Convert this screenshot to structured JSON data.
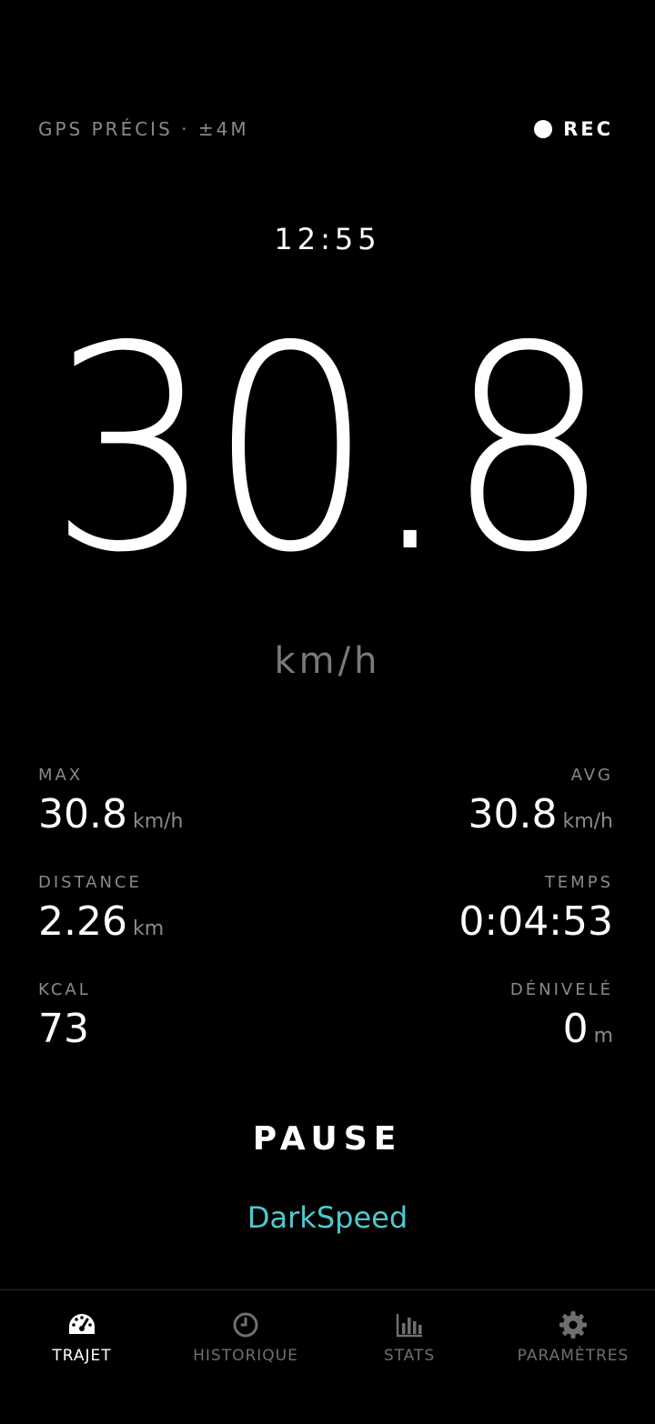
{
  "status": {
    "gps": "GPS PRÉCIS · ±4M",
    "rec_label": "REC"
  },
  "clock": "12:55",
  "speed": {
    "value": "30.8",
    "unit": "km/h"
  },
  "stats": {
    "max": {
      "label": "MAX",
      "value": "30.8",
      "unit": "km/h"
    },
    "avg": {
      "label": "AVG",
      "value": "30.8",
      "unit": "km/h"
    },
    "distance": {
      "label": "DISTANCE",
      "value": "2.26",
      "unit": "km"
    },
    "time": {
      "label": "TEMPS",
      "value": "0:04:53"
    },
    "kcal": {
      "label": "KCAL",
      "value": "73"
    },
    "elevation": {
      "label": "DÉNIVELÉ",
      "value": "0",
      "unit": "m"
    }
  },
  "pause_label": "PAUSE",
  "brand": "DarkSpeed",
  "tabs": [
    {
      "label": "TRAJET",
      "icon": "speedometer-icon",
      "active": true
    },
    {
      "label": "HISTORIQUE",
      "icon": "clock-icon",
      "active": false
    },
    {
      "label": "STATS",
      "icon": "bar-chart-icon",
      "active": false
    },
    {
      "label": "PARAMÈTRES",
      "icon": "gear-icon",
      "active": false
    }
  ],
  "colors": {
    "background": "#000000",
    "text": "#ffffff",
    "muted": "#8a8a8a",
    "accent": "#4ec9cf",
    "inactive_tab": "#6f6f6f"
  }
}
